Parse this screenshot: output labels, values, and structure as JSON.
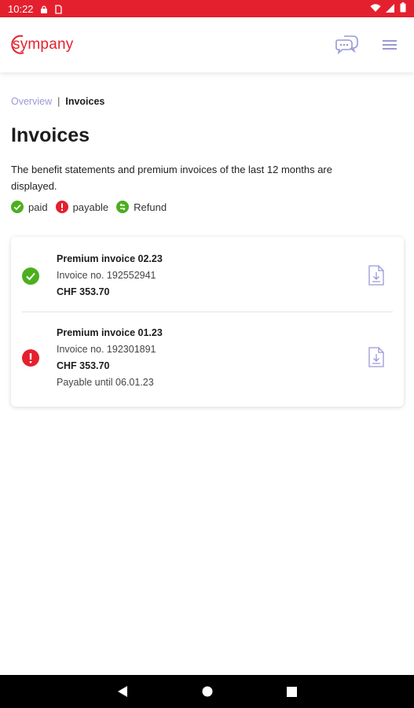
{
  "status_bar": {
    "time": "10:22",
    "icons": [
      "lock-icon",
      "sim-icon",
      "wifi-icon",
      "signal-icon",
      "battery-icon"
    ]
  },
  "app": {
    "logo_text": "sympany",
    "brand_color": "#e5202e",
    "accent_color": "#9a98d6",
    "actions": [
      "chat-icon",
      "menu-icon"
    ]
  },
  "breadcrumb": {
    "parent": "Overview",
    "separator": "|",
    "current": "Invoices"
  },
  "page": {
    "title": "Invoices",
    "description": "The benefit statements and premium invoices of the last 12 months are displayed."
  },
  "legend": {
    "paid": "paid",
    "payable": "payable",
    "refund": "Refund"
  },
  "invoices": [
    {
      "status": "paid",
      "status_color": "#4caf1e",
      "name": "Premium invoice 02.23",
      "number": "Invoice no. 192552941",
      "amount": "CHF 353.70",
      "due": ""
    },
    {
      "status": "payable",
      "status_color": "#e5202e",
      "name": "Premium invoice 01.23",
      "number": "Invoice no. 192301891",
      "amount": "CHF 353.70",
      "due": "Payable until 06.01.23"
    }
  ],
  "nav": [
    "back-icon",
    "home-icon",
    "recents-icon"
  ]
}
